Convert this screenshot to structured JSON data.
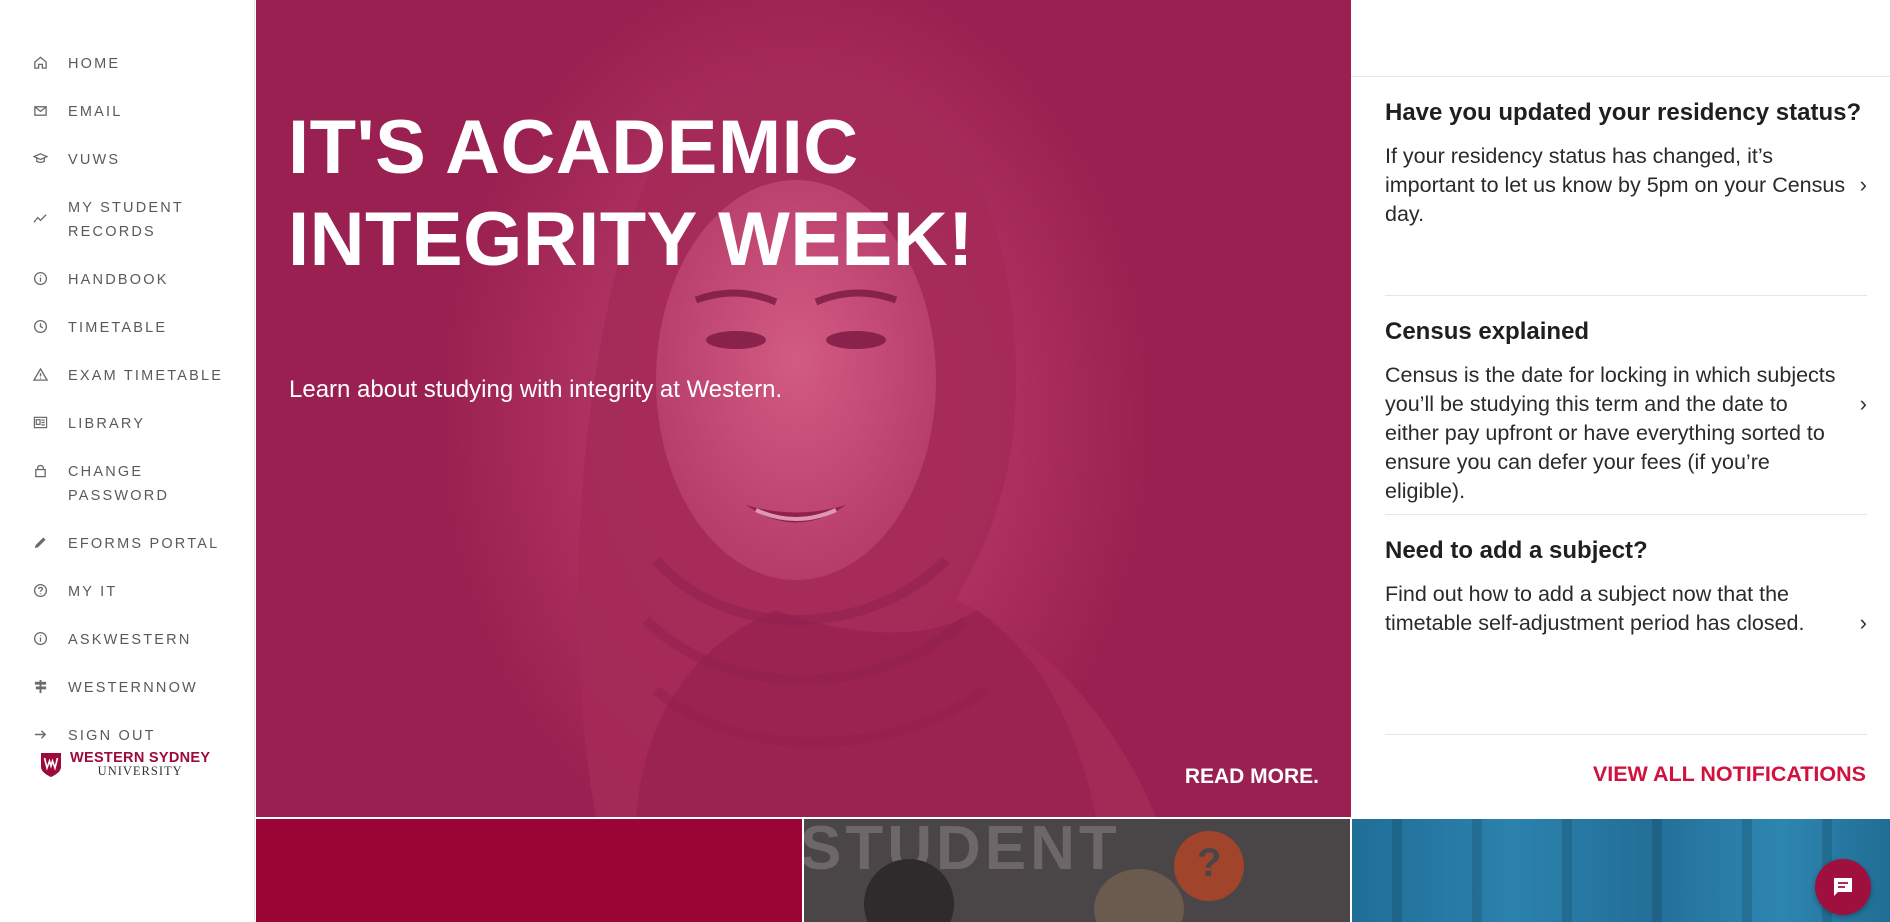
{
  "sidebar": {
    "items": [
      {
        "label": "HOME",
        "icon": "home-icon"
      },
      {
        "label": "EMAIL",
        "icon": "email-icon"
      },
      {
        "label": "VUWS",
        "icon": "graduation-cap-icon"
      },
      {
        "label": "MY STUDENT RECORDS",
        "icon": "trend-line-icon"
      },
      {
        "label": "HANDBOOK",
        "icon": "info-icon"
      },
      {
        "label": "TIMETABLE",
        "icon": "clock-icon"
      },
      {
        "label": "EXAM TIMETABLE",
        "icon": "warning-triangle-icon"
      },
      {
        "label": "LIBRARY",
        "icon": "library-icon"
      },
      {
        "label": "CHANGE PASSWORD",
        "icon": "lock-icon"
      },
      {
        "label": "EFORMS PORTAL",
        "icon": "pencil-icon"
      },
      {
        "label": "MY IT",
        "icon": "help-circle-icon"
      },
      {
        "label": "ASKWESTERN",
        "icon": "info-icon"
      },
      {
        "label": "WESTERNNOW",
        "icon": "signpost-icon"
      },
      {
        "label": "SIGN OUT",
        "icon": "arrow-right-icon"
      }
    ],
    "logo": {
      "line1": "WESTERN SYDNEY",
      "line2": "UNIVERSITY"
    }
  },
  "hero": {
    "title": "IT'S ACADEMIC INTEGRITY WEEK!",
    "subtitle": "Learn about studying with integrity at Western.",
    "read_more": "READ MORE."
  },
  "notifications": {
    "items": [
      {
        "title": "Have you updated your residency status?",
        "body": "If your residency status has changed, it’s important to let us know by 5pm on your Census day."
      },
      {
        "title": "Census explained",
        "body": "Census is the date for locking in which subjects you’ll be studying this term and the date to either pay upfront or have everything sorted to ensure you can defer your fees (if you’re eligible)."
      },
      {
        "title": "Need to add a subject?",
        "body": "Find out how to add a subject now that the timetable self-adjustment period has closed."
      }
    ],
    "arrow": "›",
    "view_all": "VIEW ALL NOTIFICATIONS"
  },
  "tiles": {
    "student_tile_text": "STUDENT",
    "student_tile_q": "?"
  },
  "colors": {
    "brand": "#9d0a3c",
    "accent": "#d1123f",
    "hero_overlay": "#b33766"
  }
}
